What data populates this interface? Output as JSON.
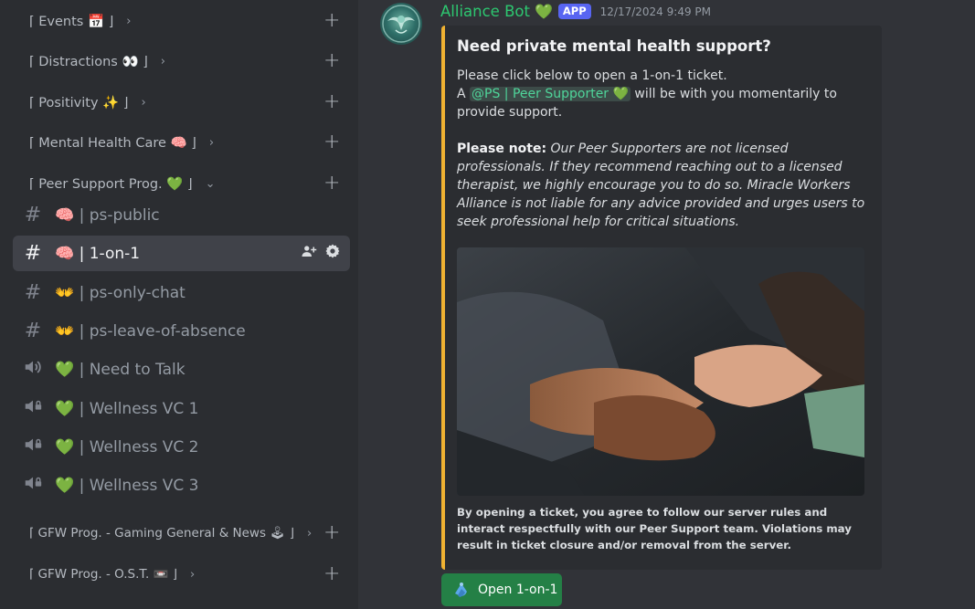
{
  "sidebar": {
    "categories_top": [
      {
        "label": "⌈ Events 📅 ⌋",
        "chevron": "›"
      },
      {
        "label": "⌈ Distractions 👀 ⌋",
        "chevron": "›"
      },
      {
        "label": "⌈ Positivity ✨ ⌋",
        "chevron": "›"
      },
      {
        "label": "⌈ Mental Health Care 🧠 ⌋",
        "chevron": "›"
      },
      {
        "label": "⌈ Peer Support Prog. 💚 ⌋",
        "chevron": "⌄"
      }
    ],
    "channels": [
      {
        "icon": "hash-icon",
        "label": "🧠 | ps-public",
        "active": false
      },
      {
        "icon": "hash-icon",
        "label": "🧠 | 1-on-1",
        "active": true
      },
      {
        "icon": "hash-locked-icon",
        "label": "👐 | ps-only-chat",
        "active": false
      },
      {
        "icon": "hash-locked-icon",
        "label": "👐 | ps-leave-of-absence",
        "active": false
      },
      {
        "icon": "speaker-icon",
        "label": "💚 | Need to Talk",
        "active": false
      },
      {
        "icon": "speaker-locked-icon",
        "label": "💚 | Wellness VC 1",
        "active": false
      },
      {
        "icon": "speaker-locked-icon",
        "label": "💚 | Wellness VC 2",
        "active": false
      },
      {
        "icon": "speaker-locked-icon",
        "label": "💚 | Wellness VC 3",
        "active": false
      }
    ],
    "categories_bottom": [
      {
        "label": "⌈ GFW Prog. - Gaming General & News 🕹 ⌋",
        "chevron": "›"
      },
      {
        "label": "⌈ GFW Prog. - O.S.T. 📼 ⌋",
        "chevron": "›"
      }
    ],
    "plus_label": "+"
  },
  "message": {
    "author": "Alliance Bot",
    "author_heart": "💚",
    "badge": "APP",
    "timestamp": "12/17/2024 9:49 PM",
    "embed": {
      "accent_color": "#f0b232",
      "title": "Need private mental health support?",
      "line1": "Please click below to open a 1-on-1 ticket.",
      "line2_prefix": "A ",
      "mention": "@PS | Peer Supporter 💚",
      "line2_suffix": " will be with you momentarily to provide support.",
      "note_label": "Please note:",
      "note_text": " Our Peer Supporters are not licensed professionals. If they recommend reaching out to a licensed therapist, we highly encourage you to do so. Miracle Workers Alliance is not liable for any advice provided and urges users to seek professional help for critical situations.",
      "footer": "By opening a ticket, you agree to follow our server rules and interact respectfully with our Peer Support team. Violations may result in ticket closure and/or removal from the server."
    },
    "button": {
      "label": "Open 1-on-1",
      "icon": "ticket-hands-icon",
      "color": "#248046"
    }
  },
  "colors": {
    "sidebar": "#2b2d31",
    "main": "#313338",
    "active_channel": "#404249",
    "author": "#2dc770",
    "badge": "#5865f2"
  }
}
